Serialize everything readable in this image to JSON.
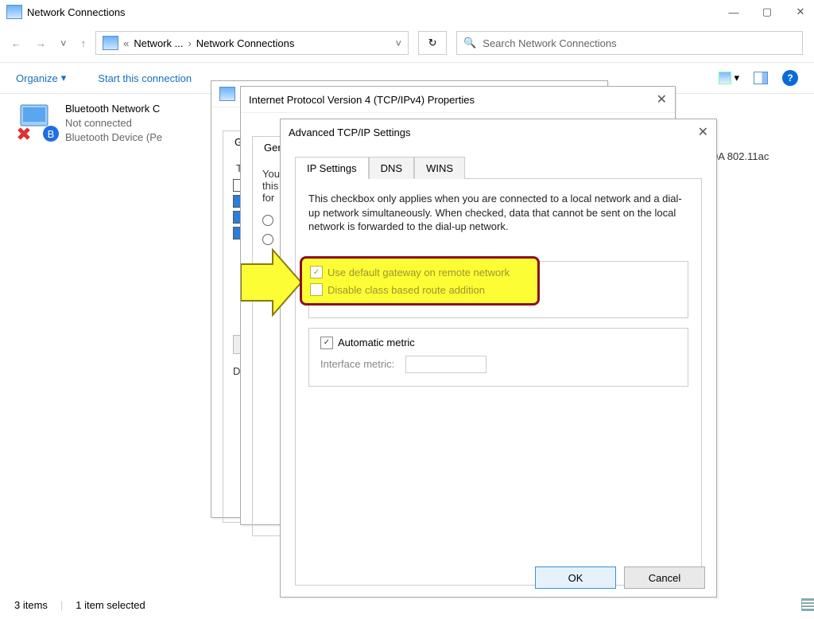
{
  "window": {
    "title": "Network Connections"
  },
  "breadcrumb": {
    "seg1": "Network ...",
    "seg2": "Network Connections"
  },
  "search": {
    "placeholder": "Search Network Connections"
  },
  "toolbar": {
    "organize": "Organize",
    "start": "Start this connection"
  },
  "connection": {
    "name": "Bluetooth Network C",
    "status": "Not connected",
    "device": "Bluetooth Device (Pe"
  },
  "peek": {
    "text": "0A 802.11ac"
  },
  "dlg1": {
    "tab": "Ge"
  },
  "dlg2": {
    "title": "Internet Protocol Version 4 (TCP/IPv4) Properties",
    "tab": "Gene",
    "line1": "You",
    "line2": "this",
    "line3": "for",
    "dlabel": "D"
  },
  "dlg3": {
    "title": "Advanced TCP/IP Settings",
    "tabs": {
      "ip": "IP Settings",
      "dns": "DNS",
      "wins": "WINS"
    },
    "desc": "This checkbox only applies when you are connected to a local network and a dial-up network simultaneously.  When checked, data that cannot be sent on the local network is forwarded to the dial-up network.",
    "hl": {
      "gateway": "Use default gateway on remote network",
      "classroute": "Disable class based route addition"
    },
    "autometric": "Automatic metric",
    "ifmetric": "Interface metric:",
    "ok": "OK",
    "cancel": "Cancel"
  },
  "status": {
    "items": "3 items",
    "selected": "1 item selected"
  }
}
